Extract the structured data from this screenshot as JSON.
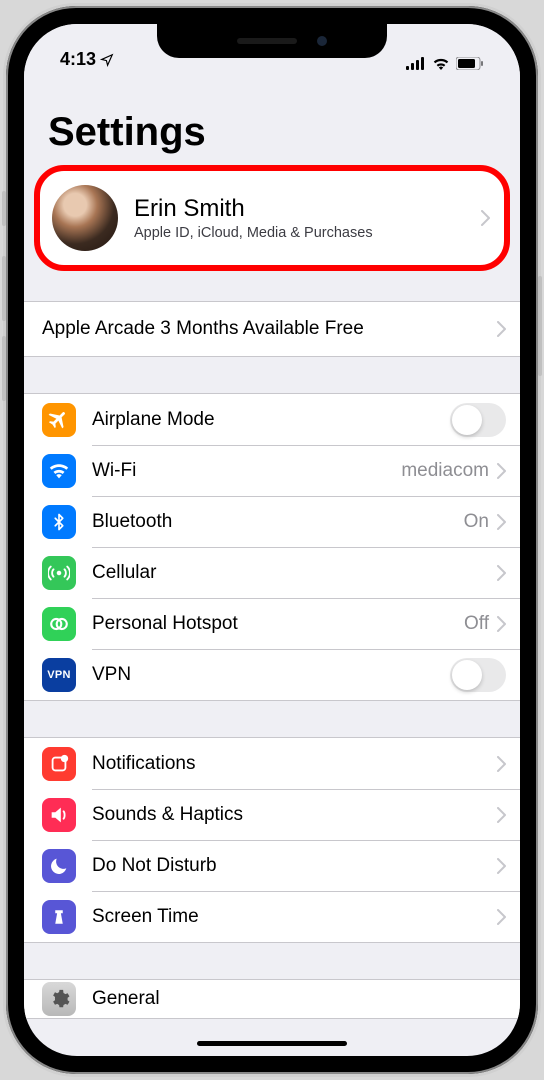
{
  "status": {
    "time": "4:13",
    "location_arrow": "→"
  },
  "page_title": "Settings",
  "profile": {
    "name": "Erin Smith",
    "subtitle": "Apple ID, iCloud, Media & Purchases"
  },
  "promo": {
    "label": "Apple Arcade 3 Months Available Free"
  },
  "group_connectivity": [
    {
      "label": "Airplane Mode",
      "icon": "airplane",
      "bg": "bg-orange",
      "control": "toggle",
      "value": ""
    },
    {
      "label": "Wi-Fi",
      "icon": "wifi",
      "bg": "bg-blue",
      "control": "disclosure",
      "value": "mediacom"
    },
    {
      "label": "Bluetooth",
      "icon": "bluetooth",
      "bg": "bg-blue",
      "control": "disclosure",
      "value": "On"
    },
    {
      "label": "Cellular",
      "icon": "cellular",
      "bg": "bg-green",
      "control": "disclosure",
      "value": ""
    },
    {
      "label": "Personal Hotspot",
      "icon": "hotspot",
      "bg": "bg-green2",
      "control": "disclosure",
      "value": "Off"
    },
    {
      "label": "VPN",
      "icon": "vpn",
      "bg": "bg-navy",
      "control": "toggle",
      "value": ""
    }
  ],
  "group_notifications": [
    {
      "label": "Notifications",
      "icon": "notifications",
      "bg": "bg-red",
      "control": "disclosure",
      "value": ""
    },
    {
      "label": "Sounds & Haptics",
      "icon": "sounds",
      "bg": "bg-pink",
      "control": "disclosure",
      "value": ""
    },
    {
      "label": "Do Not Disturb",
      "icon": "dnd",
      "bg": "bg-purple",
      "control": "disclosure",
      "value": ""
    },
    {
      "label": "Screen Time",
      "icon": "screentime",
      "bg": "bg-purple",
      "control": "disclosure",
      "value": ""
    }
  ],
  "group_general": [
    {
      "label": "General",
      "icon": "general",
      "bg": "general-icon",
      "control": "disclosure",
      "value": ""
    }
  ],
  "vpn_label": "VPN"
}
